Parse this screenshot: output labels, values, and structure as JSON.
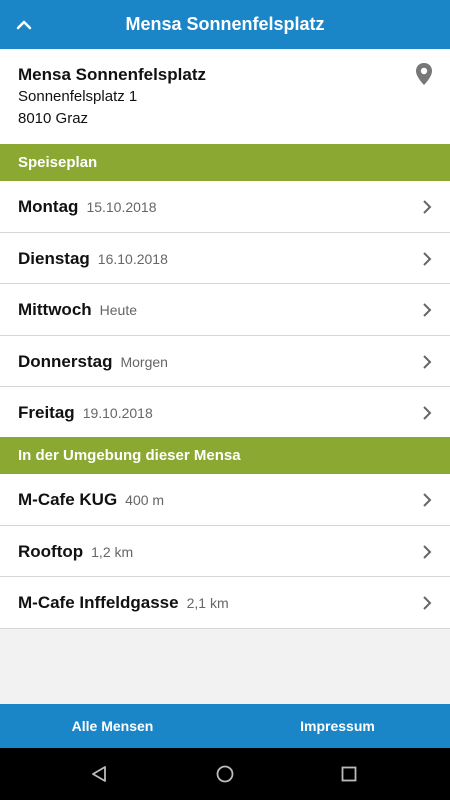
{
  "app_bar": {
    "title": "Mensa Sonnenfelsplatz",
    "up_icon": "chevron-up-icon"
  },
  "info": {
    "name": "Mensa Sonnenfelsplatz",
    "street": "Sonnenfelsplatz 1",
    "city": "8010 Graz",
    "location_icon": "map-pin-icon"
  },
  "speiseplan": {
    "header": "Speiseplan",
    "days": [
      {
        "day": "Montag",
        "detail": "15.10.2018"
      },
      {
        "day": "Dienstag",
        "detail": "16.10.2018"
      },
      {
        "day": "Mittwoch",
        "detail": "Heute"
      },
      {
        "day": "Donnerstag",
        "detail": "Morgen"
      },
      {
        "day": "Freitag",
        "detail": "19.10.2018"
      }
    ]
  },
  "nearby": {
    "header": "In der Umgebung dieser Mensa",
    "places": [
      {
        "name": "M-Cafe KUG",
        "distance": "400 m"
      },
      {
        "name": "Rooftop",
        "distance": "1,2 km"
      },
      {
        "name": "M-Cafe Inffeldgasse",
        "distance": "2,1 km"
      }
    ]
  },
  "bottom_bar": {
    "all_label": "Alle Mensen",
    "imprint_label": "Impressum"
  },
  "colors": {
    "primary": "#1a86c8",
    "section": "#8aa832"
  }
}
